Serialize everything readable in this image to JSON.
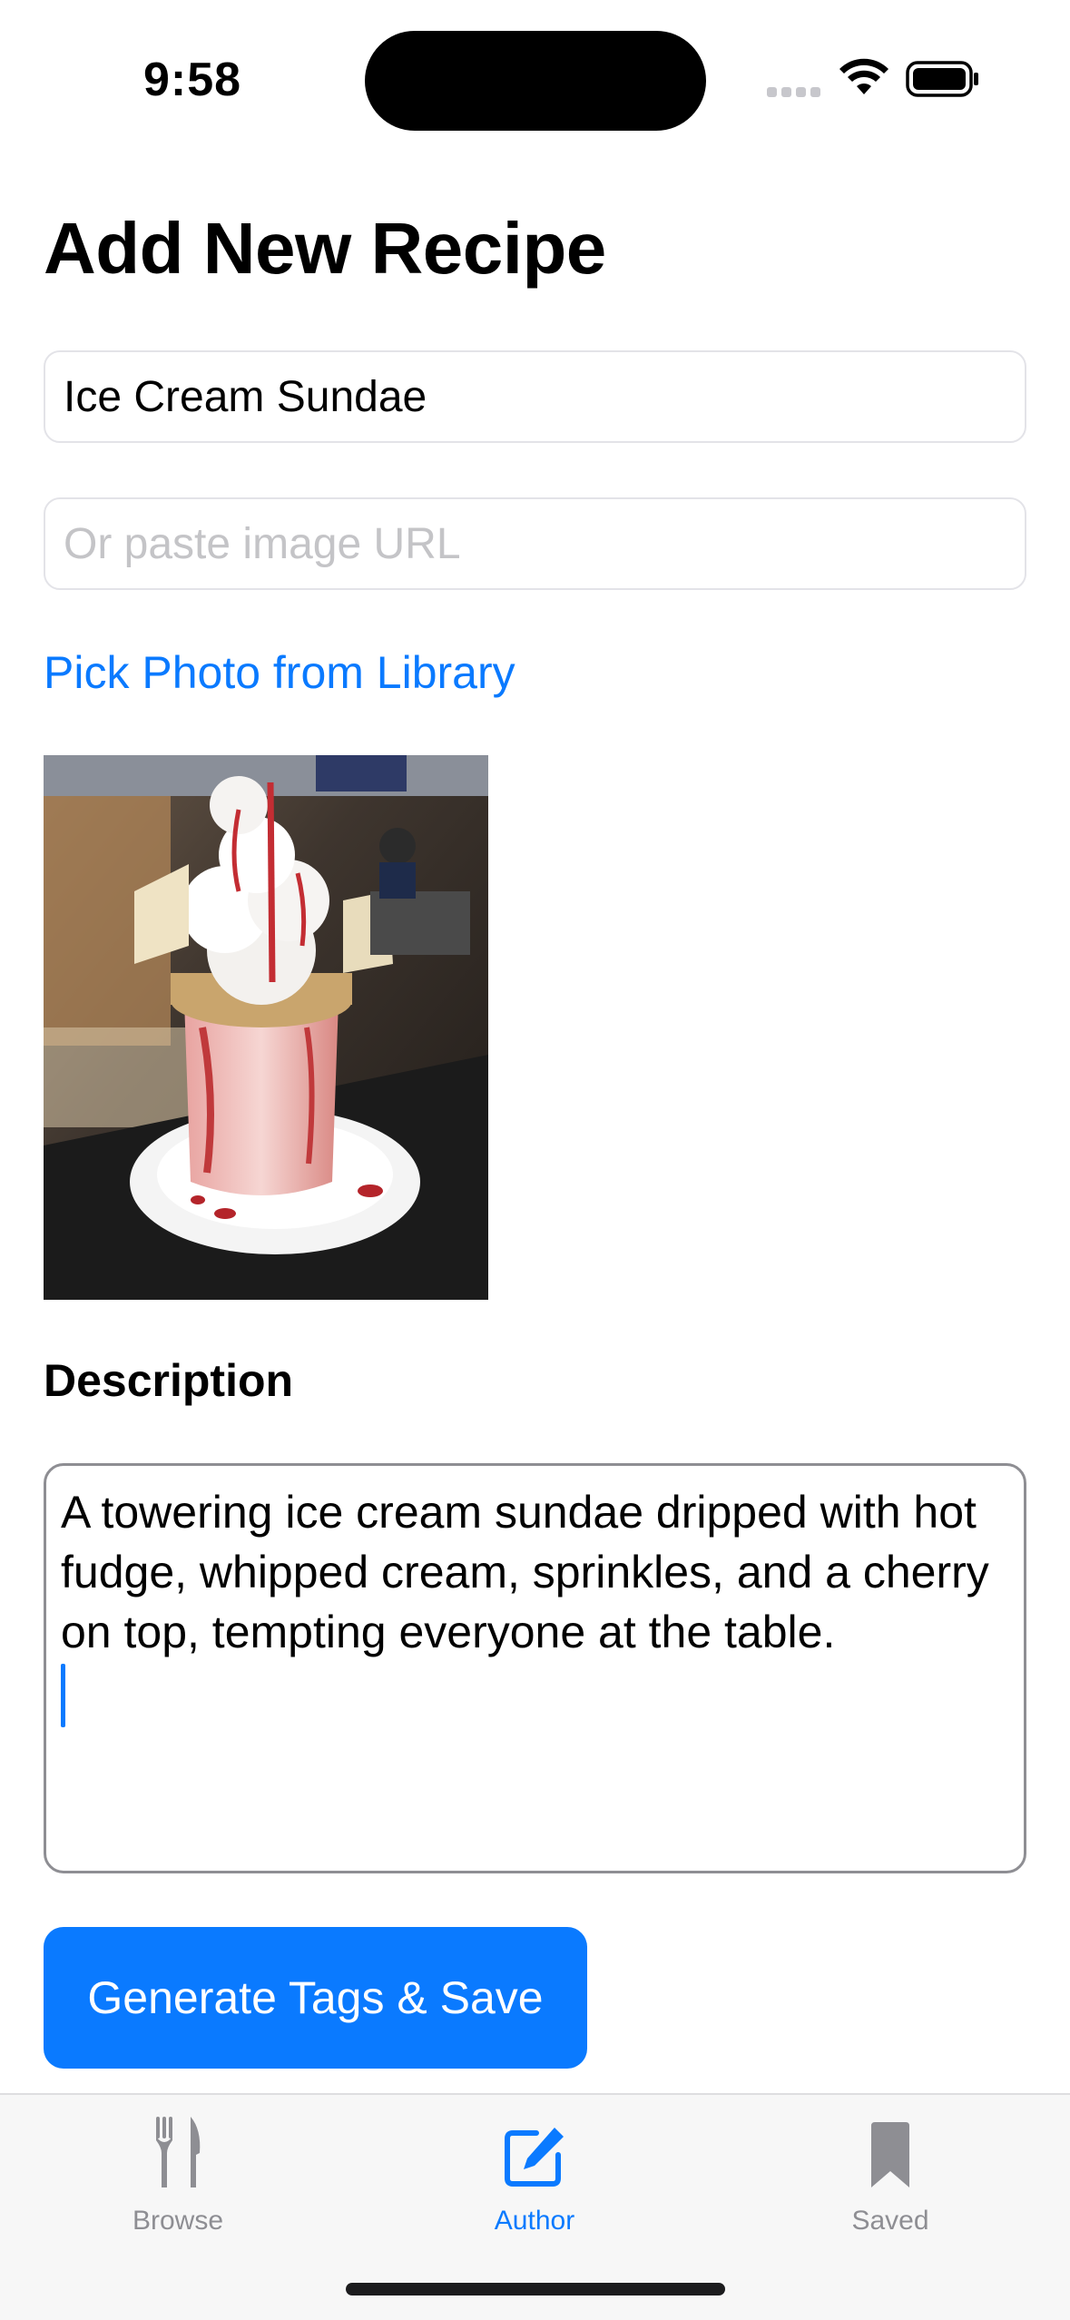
{
  "status_bar": {
    "time": "9:58",
    "icons": [
      "cellular-signal-icon",
      "wifi-icon",
      "battery-icon"
    ]
  },
  "page": {
    "title": "Add New Recipe"
  },
  "form": {
    "name_value": "Ice Cream Sundae",
    "name_placeholder": "",
    "url_value": "",
    "url_placeholder": "Or paste image URL",
    "pick_photo_label": "Pick Photo from Library",
    "photo_alt": "Ice cream sundae",
    "description_label": "Description",
    "description_value": "A towering ice cream sundae dripped with hot fudge, whipped cream, sprinkles, and a cherry on top, tempting everyone at the table.",
    "submit_label": "Generate Tags & Save"
  },
  "tab_bar": {
    "tabs": [
      {
        "label": "Browse",
        "icon": "fork-knife-icon",
        "selected": false
      },
      {
        "label": "Author",
        "icon": "compose-icon",
        "selected": true
      },
      {
        "label": "Saved",
        "icon": "bookmark-icon",
        "selected": false
      }
    ]
  },
  "colors": {
    "accent": "#0a7aff",
    "inactive_tab": "#8e8e93",
    "field_border": "#e3e3e8",
    "placeholder": "#c4c4c7"
  }
}
